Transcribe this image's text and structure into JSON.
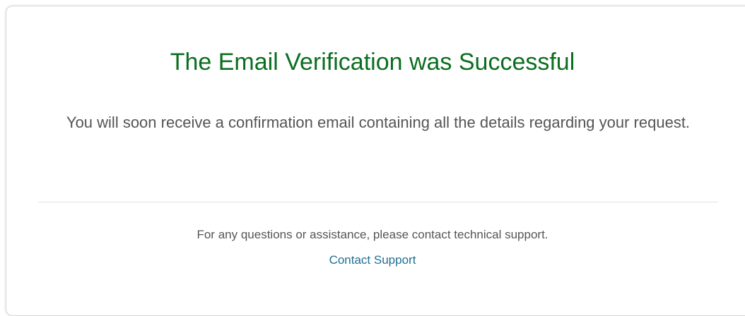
{
  "card": {
    "title": "The Email Verification was Successful",
    "message": "You will soon receive a confirmation email containing all the details regarding your request.",
    "help_text": "For any questions or assistance, please contact technical support.",
    "support_link_label": "Contact Support"
  },
  "colors": {
    "title": "#0b6e1f",
    "body_text": "#555555",
    "link": "#1f6f95",
    "divider": "#e3e3e3"
  }
}
